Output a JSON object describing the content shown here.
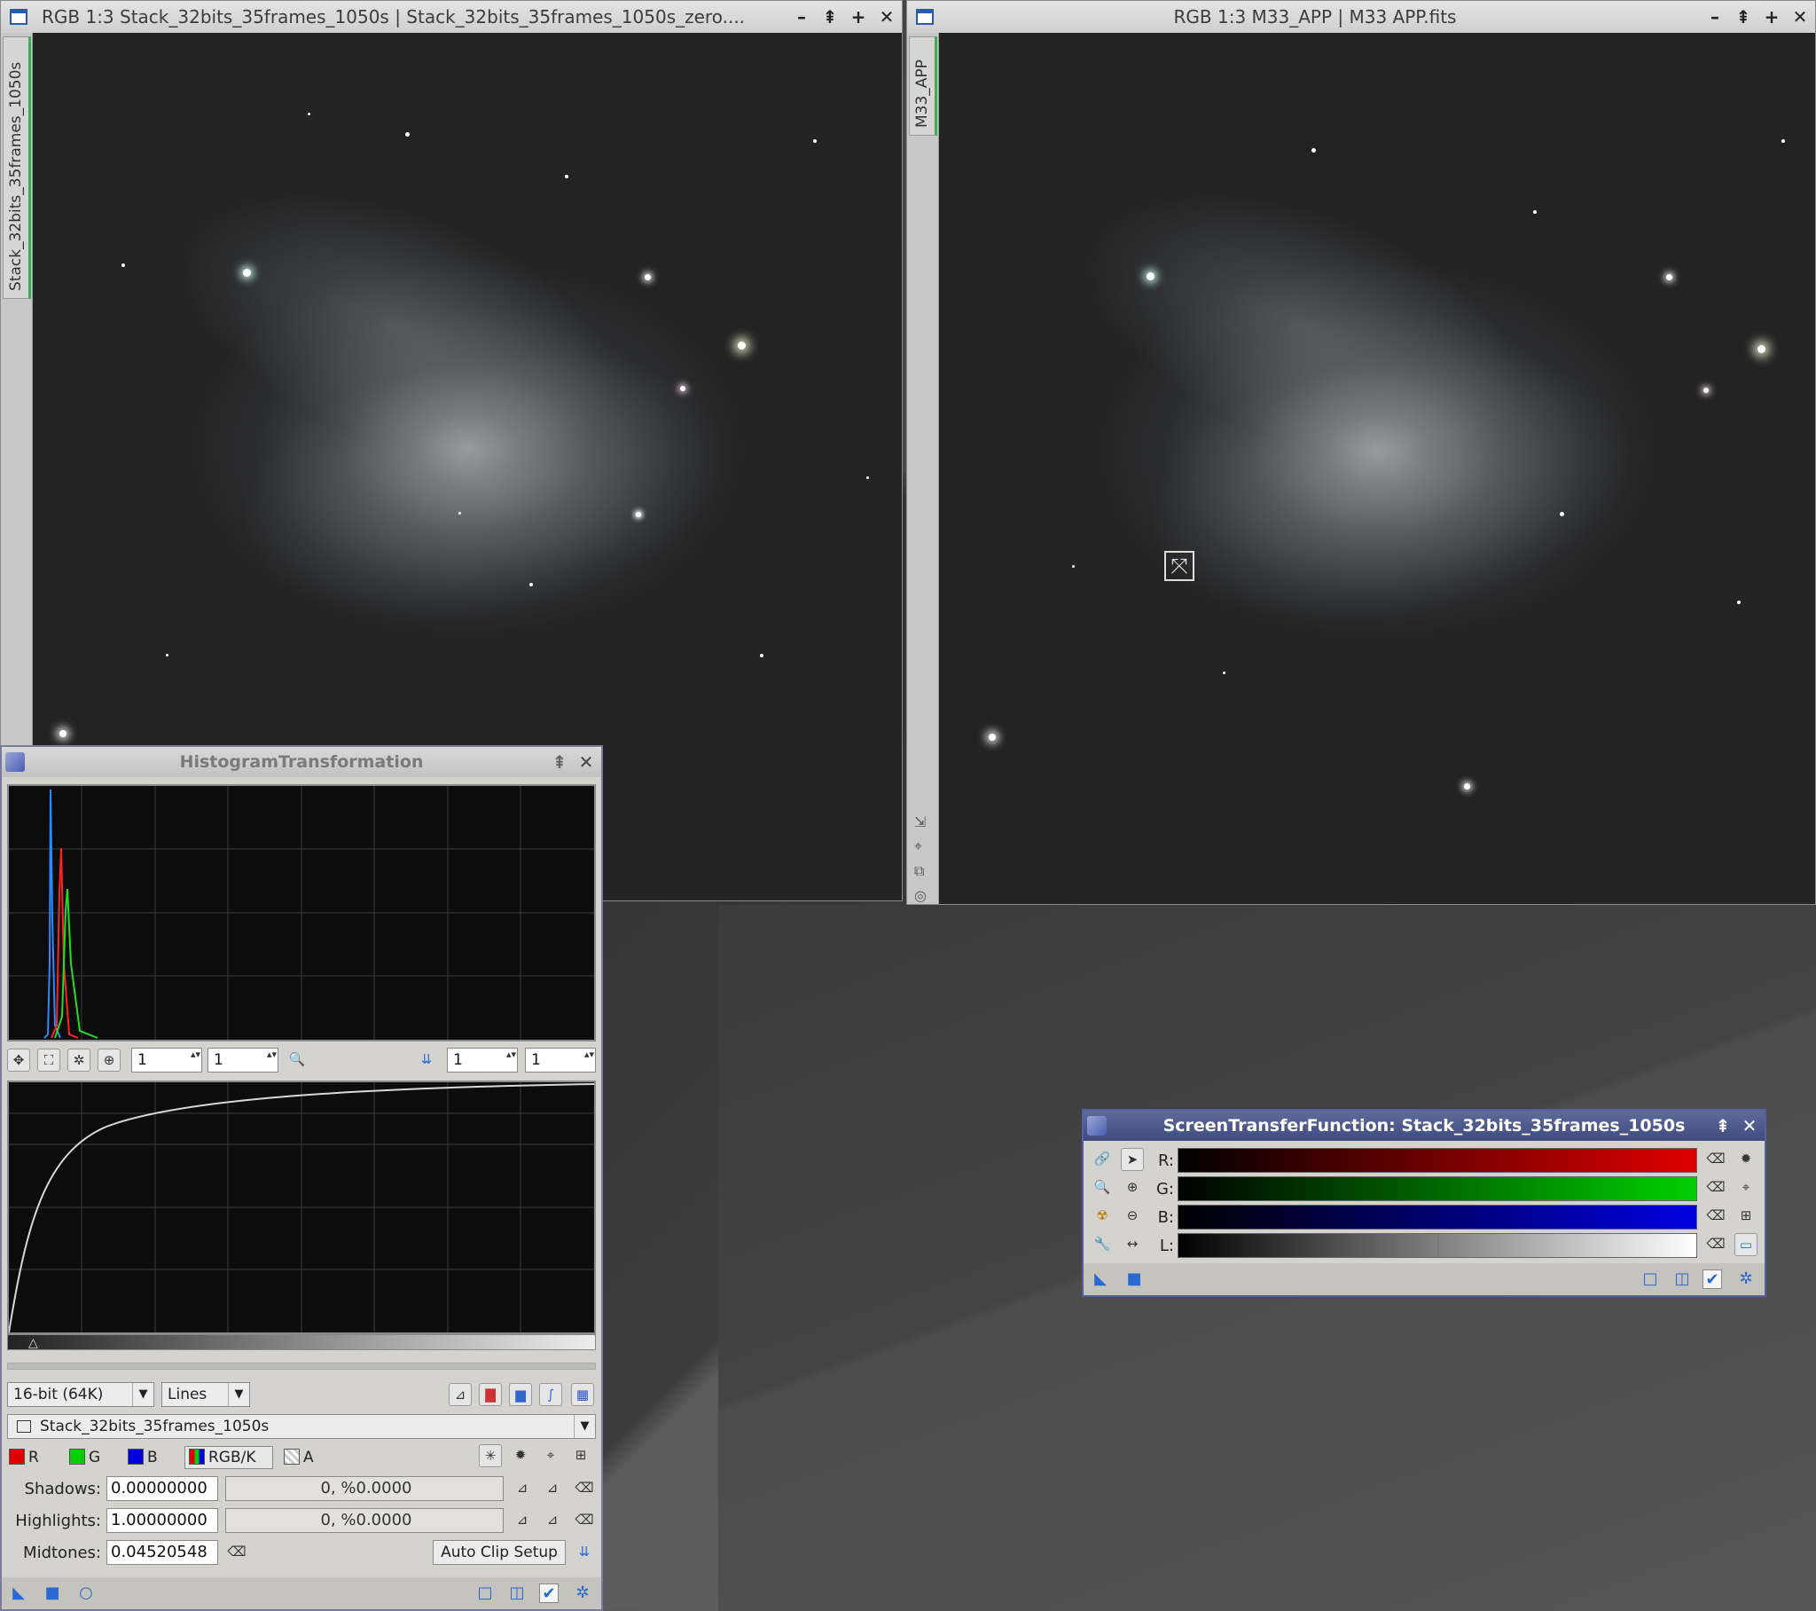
{
  "window_left": {
    "title": "RGB 1:3 Stack_32bits_35frames_1050s | Stack_32bits_35frames_1050s_zero....",
    "side_tab": "Stack_32bits_35frames_1050s"
  },
  "window_right": {
    "title": "RGB 1:3 M33_APP | M33 APP.fits",
    "side_tab": "M33_APP"
  },
  "titlebar_buttons": [
    "–",
    "⇞",
    "+",
    "✕"
  ],
  "histogram": {
    "title": "HistogramTransformation",
    "zoom_h": "1",
    "zoom_v": "1",
    "zoom_h2": "1",
    "zoom_v2": "1",
    "resolution": "16-bit (64K)",
    "graph_style": "Lines",
    "view": "Stack_32bits_35frames_1050s",
    "channels": {
      "r": "R",
      "g": "G",
      "b": "B",
      "rgbk": "RGB/K",
      "a": "A"
    },
    "shadows_label": "Shadows:",
    "shadows_value": "0.00000000",
    "shadows_clip": "0, %0.0000",
    "highlights_label": "Highlights:",
    "highlights_value": "1.00000000",
    "highlights_clip": "0, %0.0000",
    "midtones_label": "Midtones:",
    "midtones_value": "0.04520548",
    "auto_clip": "Auto Clip Setup"
  },
  "stf": {
    "title": "ScreenTransferFunction: Stack_32bits_35frames_1050s",
    "labels": {
      "r": "R:",
      "g": "G:",
      "b": "B:",
      "l": "L:"
    },
    "l_midtone_fraction": 0.5
  },
  "colors": {
    "red": "#e00000",
    "green": "#00d000",
    "blue": "#0000e0",
    "accent": "#2a6ad0"
  }
}
